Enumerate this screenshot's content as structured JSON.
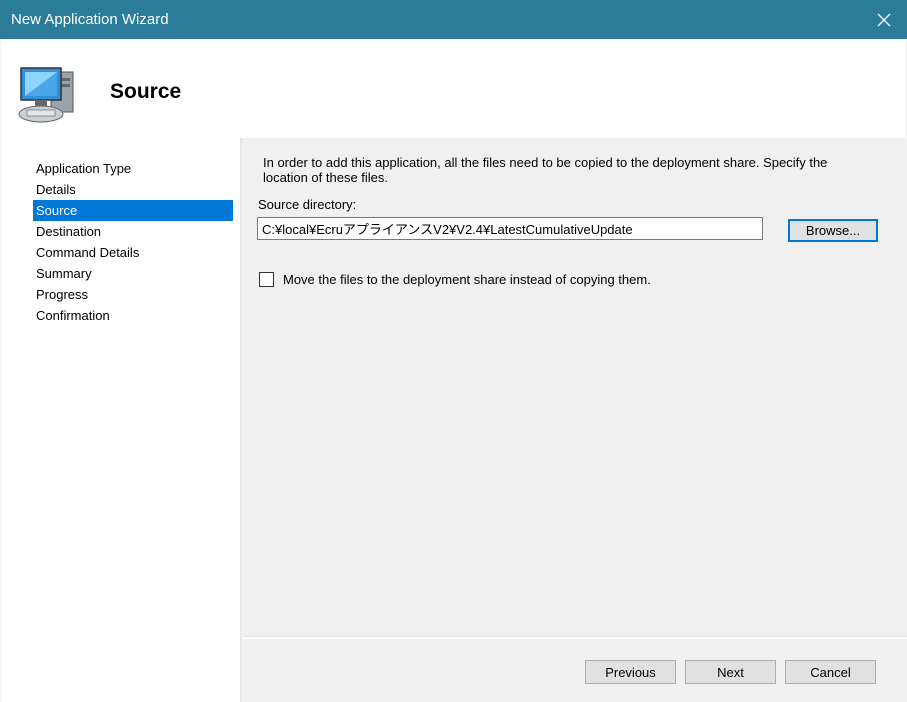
{
  "window": {
    "title": "New Application Wizard",
    "close_label": "✕"
  },
  "header": {
    "title": "Source",
    "icon": "computer-icon"
  },
  "sidebar": {
    "items": [
      {
        "label": "Application Type"
      },
      {
        "label": "Details"
      },
      {
        "label": "Source",
        "selected": true
      },
      {
        "label": "Destination"
      },
      {
        "label": "Command Details"
      },
      {
        "label": "Summary"
      },
      {
        "label": "Progress"
      },
      {
        "label": "Confirmation"
      }
    ]
  },
  "main": {
    "instructions": "In order to add this application, all the files need to be copied to the deployment share.  Specify the location of these files.",
    "source_label": "Source directory:",
    "source_value": "C:¥local¥EcruアプライアンスV2¥V2.4¥LatestCumulativeUpdate",
    "browse_label": "Browse...",
    "move_checkbox_label": "Move the files to the deployment share instead of copying them.",
    "move_checked": false
  },
  "footer": {
    "previous_label": "Previous",
    "next_label": "Next",
    "cancel_label": "Cancel"
  },
  "colors": {
    "titlebar": "#2b7c9b",
    "selection": "#0078d7"
  }
}
